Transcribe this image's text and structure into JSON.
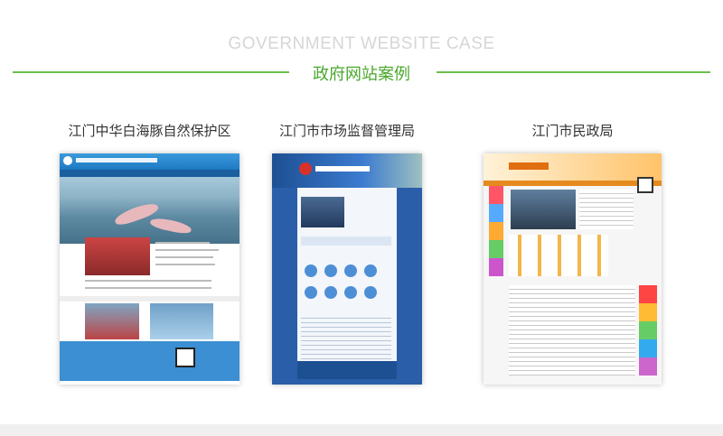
{
  "header": {
    "title_en": "GOVERNMENT WEBSITE CASE",
    "title_cn": "政府网站案例"
  },
  "cases": [
    {
      "label": "江门中华白海豚自然保护区"
    },
    {
      "label": "江门市市场监督管理局"
    },
    {
      "label": "江门市民政局"
    }
  ],
  "colors": {
    "accent_green": "#6cbf4c",
    "title_green": "#4aa82c"
  }
}
